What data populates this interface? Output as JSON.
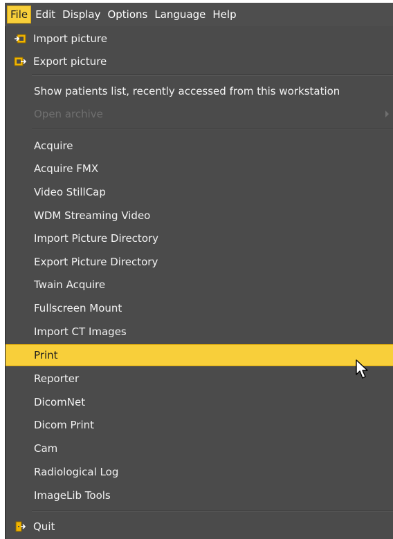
{
  "menubar": {
    "items": [
      "File",
      "Edit",
      "Display",
      "Options",
      "Language",
      "Help"
    ]
  },
  "file_menu": {
    "items": [
      {
        "label": "Import picture",
        "icon": "import-picture-icon"
      },
      {
        "label": "Export picture",
        "icon": "export-picture-icon"
      },
      {
        "label": "Show patients list, recently accessed from this workstation"
      },
      {
        "label": "Open archive",
        "disabled": true,
        "submenu": true
      },
      {
        "label": "Acquire"
      },
      {
        "label": "Acquire FMX"
      },
      {
        "label": "Video StillCap"
      },
      {
        "label": "WDM Streaming Video"
      },
      {
        "label": "Import Picture Directory"
      },
      {
        "label": "Export Picture Directory"
      },
      {
        "label": "Twain Acquire"
      },
      {
        "label": "Fullscreen Mount"
      },
      {
        "label": "Import CT Images"
      },
      {
        "label": "Print",
        "highlighted": true
      },
      {
        "label": "Reporter"
      },
      {
        "label": "DicomNet"
      },
      {
        "label": "Dicom Print"
      },
      {
        "label": "Cam"
      },
      {
        "label": "Radiological Log"
      },
      {
        "label": "ImageLib Tools"
      },
      {
        "label": "Quit",
        "icon": "quit-icon"
      }
    ]
  },
  "colors": {
    "menu_bg": "#4b4b4b",
    "highlight": "#f8cf3a",
    "text": "#f2f2f2",
    "disabled_text": "#6f6f6f",
    "icon_accent": "#f0b400"
  }
}
